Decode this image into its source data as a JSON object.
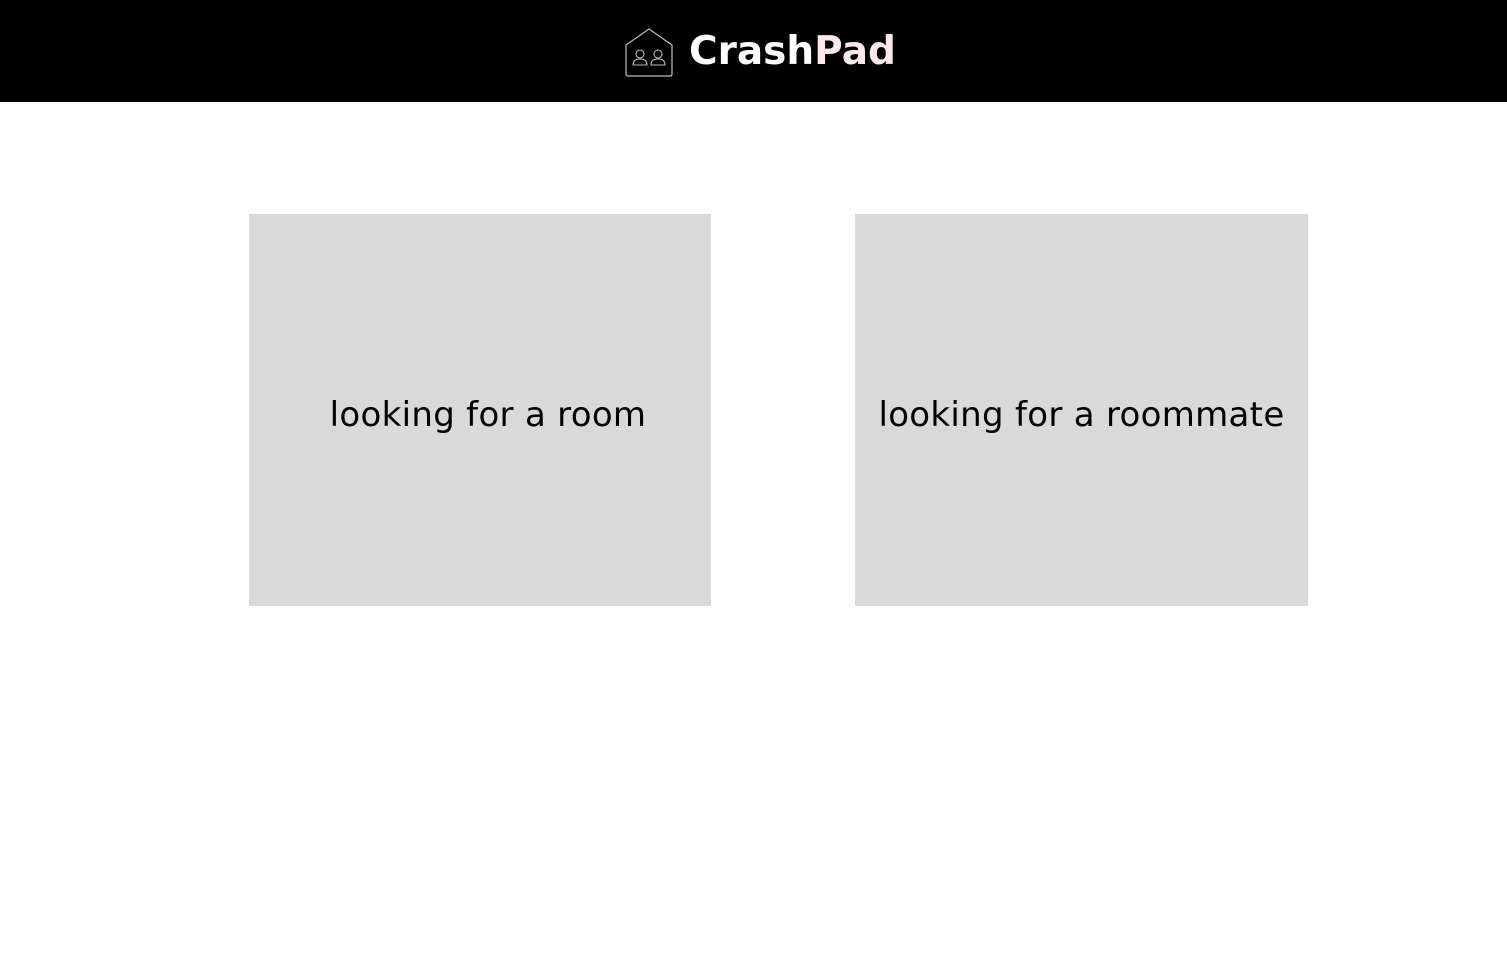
{
  "header": {
    "brand_prefix": "Crash",
    "brand_suffix": "Pad",
    "logo_icon": "house-with-two-people-icon",
    "background_color": "#000000",
    "brand_color": "#ffffff",
    "accent_color": "#fbe9ec"
  },
  "main": {
    "options": [
      {
        "label": "looking for a room"
      },
      {
        "label": "looking for a roommate"
      }
    ],
    "card_color": "#d9d9d9"
  }
}
